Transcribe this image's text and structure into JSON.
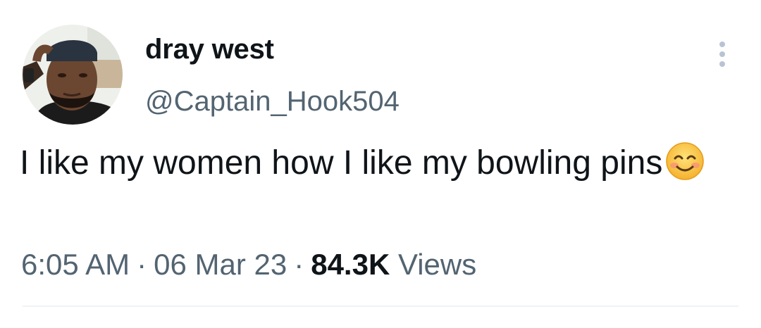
{
  "author": {
    "display_name": "dray west",
    "handle": "@Captain_Hook504",
    "avatar_icon": "profile-photo"
  },
  "menu": {
    "icon": "more-vertical-icon"
  },
  "tweet": {
    "text": "I like my women how I like my bowling pins",
    "emoji": "smiling-face-with-smiling-eyes-emoji"
  },
  "meta": {
    "time": "6:05 AM",
    "separator": "·",
    "date": "06 Mar 23",
    "views_count": "84.3K",
    "views_label": "Views"
  },
  "colors": {
    "text_primary": "#0f1419",
    "text_secondary": "#536471",
    "divider": "#eff3f4",
    "menu_dots": "#b8c4d3"
  }
}
